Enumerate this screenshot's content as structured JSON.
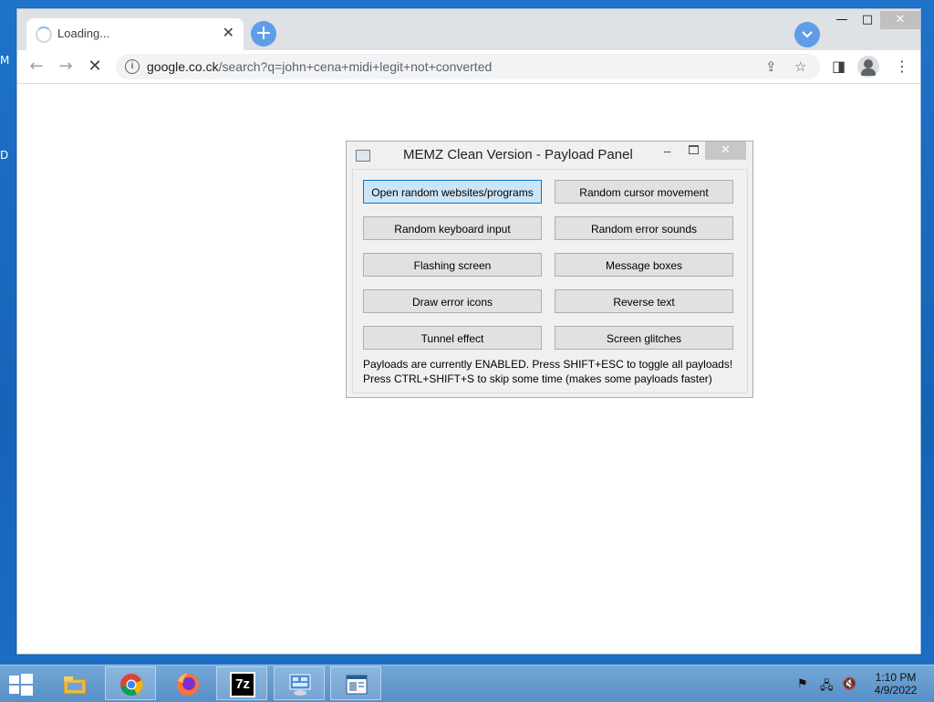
{
  "desktop": {
    "glyphs": [
      "M",
      "D"
    ]
  },
  "browser": {
    "tab_title": "Loading...",
    "tab_close": "✕",
    "new_tab": "+",
    "tab_search": "⌄",
    "window_controls": {
      "minimize": "—",
      "maximize": "□",
      "close": "✕"
    },
    "url_host": "google.co.ck",
    "url_path": "/search?q=john+cena+midi+legit+not+converted",
    "back": "←",
    "forward": "→",
    "stop": "✕",
    "share": "⇪",
    "bookmark": "☆",
    "side_panel": "◨",
    "menu": "⋮"
  },
  "dialog": {
    "title": "MEMZ Clean Version - Payload Panel",
    "buttons": [
      "Open random websites/programs",
      "Random cursor movement",
      "Random keyboard input",
      "Random error sounds",
      "Flashing screen",
      "Message boxes",
      "Draw error icons",
      "Reverse text",
      "Tunnel effect",
      "Screen glitches"
    ],
    "status_line1": "Payloads are currently ENABLED. Press SHIFT+ESC to toggle all payloads!",
    "status_line2": "Press CTRL+SHIFT+S to skip some time (makes some payloads faster)",
    "close": "✕",
    "minimize": "–"
  },
  "taskbar": {
    "apps": [
      "file-explorer-icon",
      "chrome-icon",
      "firefox-icon",
      "7zip-icon",
      "network-app-icon",
      "window-app-icon"
    ],
    "seven_zip_label": "7z",
    "clock_time": "1:10 PM",
    "clock_date": "4/9/2022"
  }
}
